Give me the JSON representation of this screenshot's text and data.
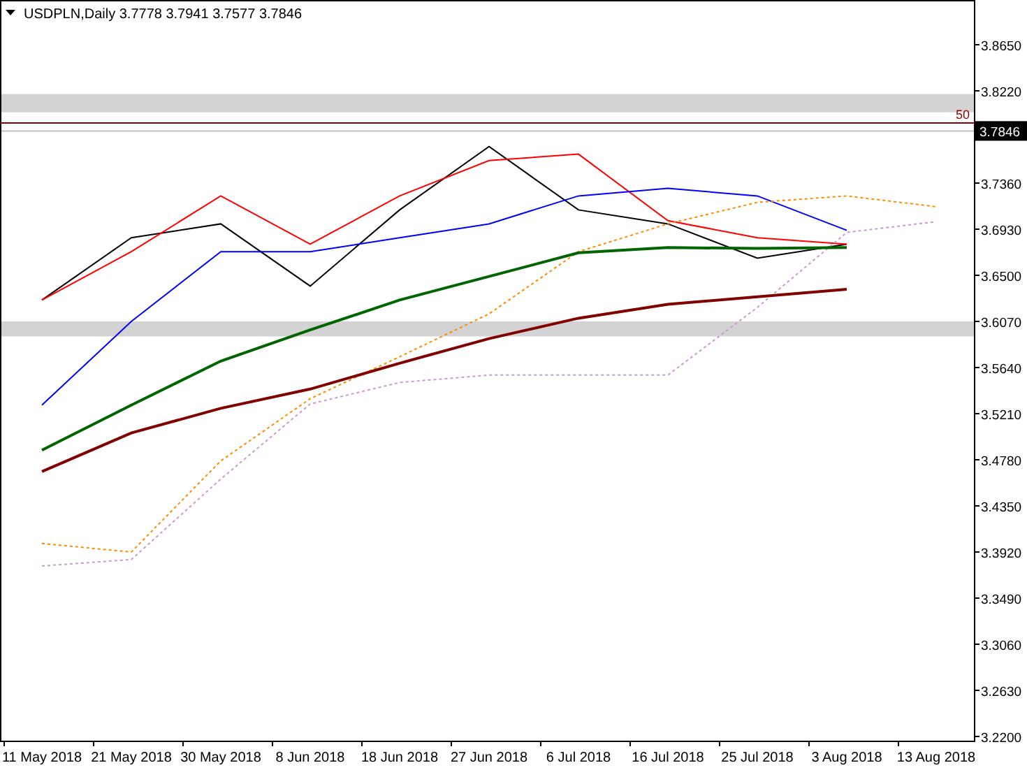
{
  "header": {
    "symbol": "USDPLN,Daily",
    "open": "3.7778",
    "high": "3.7941",
    "low": "3.7577",
    "close": "3.7846"
  },
  "chart_data": {
    "type": "line",
    "categories": [
      "11 May 2018",
      "21 May 2018",
      "30 May 2018",
      "8 Jun 2018",
      "18 Jun 2018",
      "27 Jun 2018",
      "6 Jul 2018",
      "16 Jul 2018",
      "25 Jul 2018",
      "3 Aug 2018",
      "13 Aug 2018"
    ],
    "series": [
      {
        "color": "#000000",
        "values": [
          3.627,
          3.685,
          3.698,
          3.64,
          3.711,
          3.77,
          3.711,
          3.698,
          3.666,
          3.679,
          null
        ]
      },
      {
        "color": "#ff0000",
        "values": [
          3.627,
          3.672,
          3.724,
          3.679,
          3.724,
          3.757,
          3.763,
          3.701,
          3.685,
          3.679,
          null
        ]
      },
      {
        "color": "#0000ff",
        "values": [
          3.529,
          3.607,
          3.672,
          3.672,
          3.685,
          3.698,
          3.724,
          3.731,
          3.724,
          3.692,
          null
        ]
      },
      {
        "color": "#ff8c00",
        "line_style": "dashed",
        "values": [
          3.4,
          3.392,
          3.477,
          3.535,
          3.574,
          3.614,
          3.672,
          3.698,
          3.718,
          3.724,
          3.714
        ]
      },
      {
        "color": "#cc99cc",
        "line_style": "dashed",
        "values": [
          3.379,
          3.385,
          3.46,
          3.53,
          3.55,
          3.557,
          3.557,
          3.557,
          3.62,
          3.69,
          3.7
        ]
      },
      {
        "color": "#006400",
        "values": [
          3.487,
          3.529,
          3.57,
          3.599,
          3.627,
          3.649,
          3.671,
          3.676,
          3.675,
          3.676,
          null
        ]
      },
      {
        "color": "#800000",
        "values": [
          3.467,
          3.503,
          3.526,
          3.544,
          3.568,
          3.591,
          3.61,
          3.623,
          3.63,
          3.637,
          null
        ]
      }
    ],
    "ylim": [
      3.2161,
      3.9067
    ],
    "yticks": [
      {
        "value": 3.865,
        "label": "3.8650"
      },
      {
        "value": 3.822,
        "label": "3.8220"
      },
      {
        "value": 3.736,
        "label": "3.7360"
      },
      {
        "value": 3.693,
        "label": "3.6930"
      },
      {
        "value": 3.65,
        "label": "3.6500"
      },
      {
        "value": 3.607,
        "label": "3.6070"
      },
      {
        "value": 3.564,
        "label": "3.5640"
      },
      {
        "value": 3.521,
        "label": "3.5210"
      },
      {
        "value": 3.478,
        "label": "3.4780"
      },
      {
        "value": 3.435,
        "label": "3.4350"
      },
      {
        "value": 3.392,
        "label": "3.3920"
      },
      {
        "value": 3.349,
        "label": "3.3490"
      },
      {
        "value": 3.306,
        "label": "3.3060"
      },
      {
        "value": 3.263,
        "label": "3.2630"
      },
      {
        "value": 3.22,
        "label": "3.2200"
      }
    ],
    "bands": [
      {
        "axis": "y",
        "from": 3.802,
        "to": 3.819,
        "color": "#d3d3d3"
      },
      {
        "axis": "y",
        "from": 3.593,
        "to": 3.607,
        "color": "#d3d3d3"
      }
    ],
    "ref_lines": [
      {
        "axis": "y",
        "value": 3.792,
        "color": "#8b0000"
      },
      {
        "axis": "y",
        "value": 3.7846,
        "label": "3.7846",
        "color": "#c0c0c0"
      }
    ]
  },
  "level_tag": "50"
}
